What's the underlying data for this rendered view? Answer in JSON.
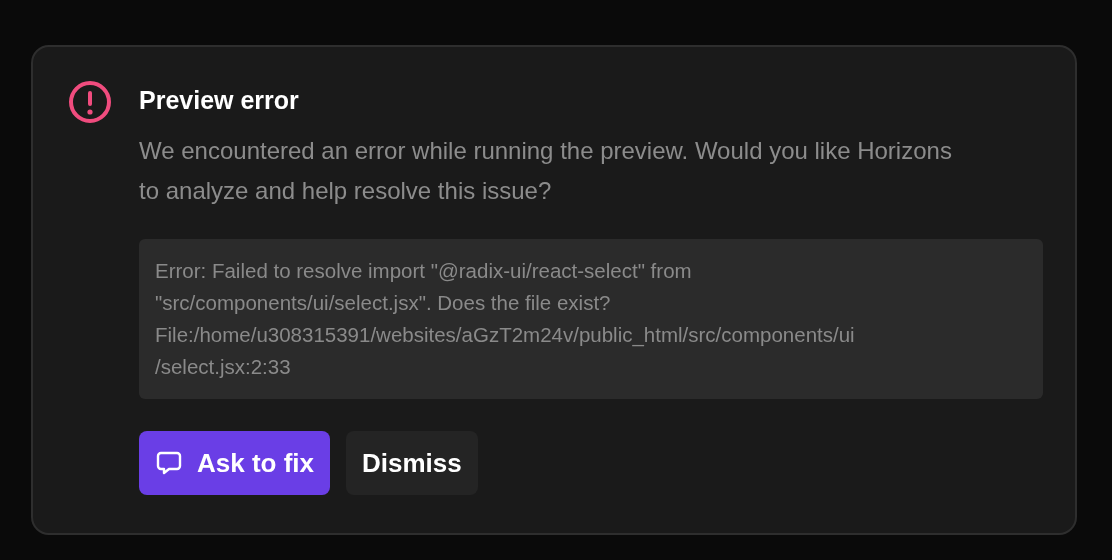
{
  "dialog": {
    "title": "Preview error",
    "message": "We encountered an error while running the preview. Would you like Horizons to analyze and help resolve this issue?",
    "error_lines": [
      "Error: Failed to resolve import \"@radix-ui/react-select\" from",
      "\"src/components/ui/select.jsx\". Does the file exist?",
      "File:/home/u308315391/websites/aGzT2m24v/public_html/src/components/ui",
      "/select.jsx:2:33"
    ],
    "buttons": [
      {
        "label": "Ask to fix",
        "kind": "primary"
      },
      {
        "label": "Dismiss",
        "kind": "secondary"
      }
    ]
  }
}
